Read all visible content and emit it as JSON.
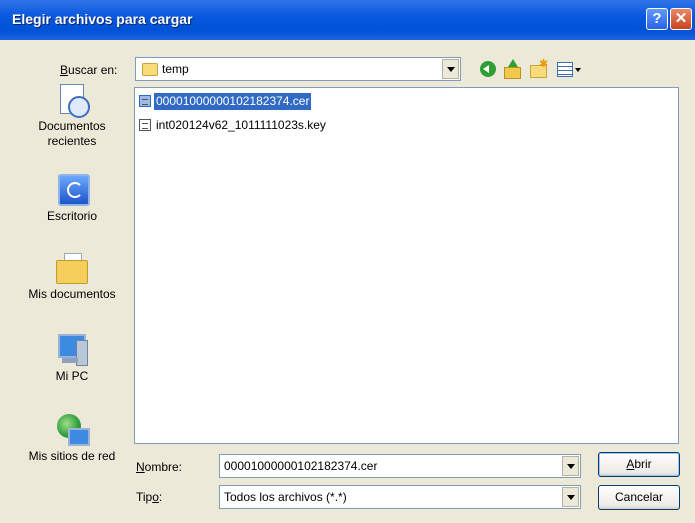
{
  "window": {
    "title": "Elegir archivos para cargar",
    "help_label": "?",
    "close_label": "✕"
  },
  "lookin": {
    "label_prefix": "",
    "label_mnemonic": "B",
    "label_rest": "uscar en:",
    "value": "temp"
  },
  "toolbar": {
    "back_icon": "back-icon",
    "up_icon": "up-folder-icon",
    "newfolder_icon": "new-folder-icon",
    "views_icon": "views-menu-icon"
  },
  "places": [
    {
      "label": "Documentos recientes",
      "icon": "recent-documents-icon"
    },
    {
      "label": "Escritorio",
      "icon": "desktop-icon"
    },
    {
      "label": "Mis documentos",
      "icon": "my-documents-icon"
    },
    {
      "label": "Mi PC",
      "icon": "my-computer-icon"
    },
    {
      "label": "Mis sitios de red",
      "icon": "network-places-icon"
    }
  ],
  "files": [
    {
      "name": "00001000000102182374.cer",
      "selected": true
    },
    {
      "name": "int020124v62_1011111023s.key",
      "selected": false
    }
  ],
  "filename": {
    "label_mnemonic": "N",
    "label_rest": "ombre:",
    "value": "00001000000102182374.cer"
  },
  "filetype": {
    "label_prefix": "Tip",
    "label_mnemonic": "o",
    "label_rest": ":",
    "value": "Todos los archivos (*.*)"
  },
  "buttons": {
    "open_mnemonic": "A",
    "open_rest": "brir",
    "cancel": "Cancelar"
  },
  "colors": {
    "titlebar": "#0a58e0",
    "selection": "#316ac5",
    "dialog_bg": "#ece9d8"
  }
}
